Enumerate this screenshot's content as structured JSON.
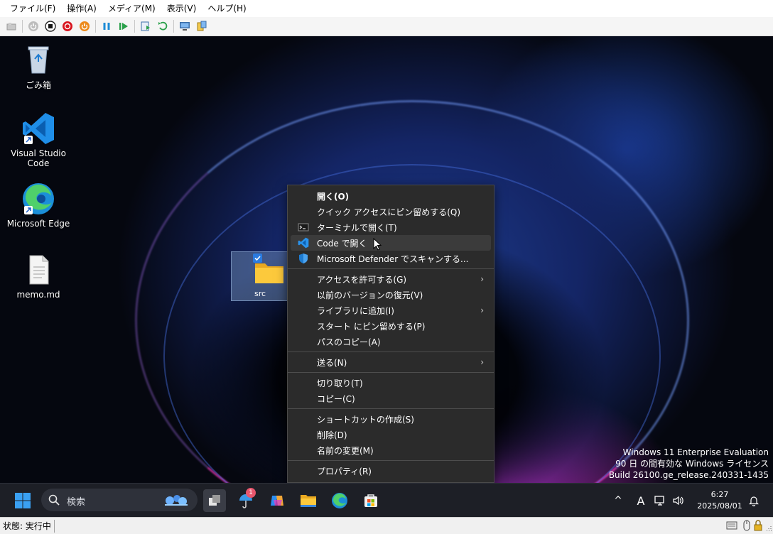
{
  "menubar": {
    "items": [
      "ファイル(F)",
      "操作(A)",
      "メディア(M)",
      "表示(V)",
      "ヘルプ(H)"
    ]
  },
  "toolbar": {
    "buttons": [
      "ctrl-alt-del-icon",
      "start-icon",
      "turn-off-icon",
      "shutdown-icon",
      "power-reset-icon",
      "pause-icon",
      "resume-icon",
      "checkpoint-icon",
      "revert-icon",
      "enhanced-session-icon",
      "share-icon"
    ]
  },
  "desktop": {
    "icons": [
      {
        "label": "ごみ箱",
        "icon": "recycle-bin-icon"
      },
      {
        "label": "Visual Studio Code",
        "icon": "vscode-icon"
      },
      {
        "label": "Microsoft Edge",
        "icon": "edge-icon"
      },
      {
        "label": "memo.md",
        "icon": "document-icon"
      }
    ],
    "selected_folder": {
      "label": "src",
      "icon": "folder-icon"
    }
  },
  "context_menu": {
    "group1": [
      {
        "label": "開く(O)",
        "bold": true
      },
      {
        "label": "クイック アクセスにピン留めする(Q)"
      },
      {
        "label": "ターミナルで開く(T)",
        "icon": "terminal-icon"
      },
      {
        "label": "Code で開く",
        "icon": "vscode-icon",
        "highlighted": true
      },
      {
        "label": "Microsoft Defender でスキャンする...",
        "icon": "defender-shield-icon"
      }
    ],
    "group2": [
      {
        "label": "アクセスを許可する(G)",
        "submenu": true
      },
      {
        "label": "以前のバージョンの復元(V)"
      },
      {
        "label": "ライブラリに追加(I)",
        "submenu": true
      },
      {
        "label": "スタート にピン留めする(P)"
      },
      {
        "label": "パスのコピー(A)"
      }
    ],
    "group3": [
      {
        "label": "送る(N)",
        "submenu": true
      }
    ],
    "group4": [
      {
        "label": "切り取り(T)"
      },
      {
        "label": "コピー(C)"
      }
    ],
    "group5": [
      {
        "label": "ショートカットの作成(S)"
      },
      {
        "label": "削除(D)"
      },
      {
        "label": "名前の変更(M)"
      }
    ],
    "group6": [
      {
        "label": "プロパティ(R)"
      }
    ],
    "submenu_arrow": "›"
  },
  "watermark": {
    "line1": "Windows 11 Enterprise Evaluation",
    "line2": "90 日 の間有効な Windows ライセンス",
    "line3": "Build 26100.ge_release.240331-1435"
  },
  "taskbar": {
    "search_placeholder": "検索",
    "weather_badge": "1",
    "time": "6:27",
    "date": "2025/08/01",
    "ime_indicator": "A",
    "tray_chevron": "^"
  },
  "statusbar": {
    "text": "状態: 実行中"
  },
  "colors": {
    "menu_bg": "#2b2b2b",
    "menu_highlight": "#3b3b3b",
    "taskbar_bg": "#1d1f26",
    "accent": "#0078d4"
  }
}
